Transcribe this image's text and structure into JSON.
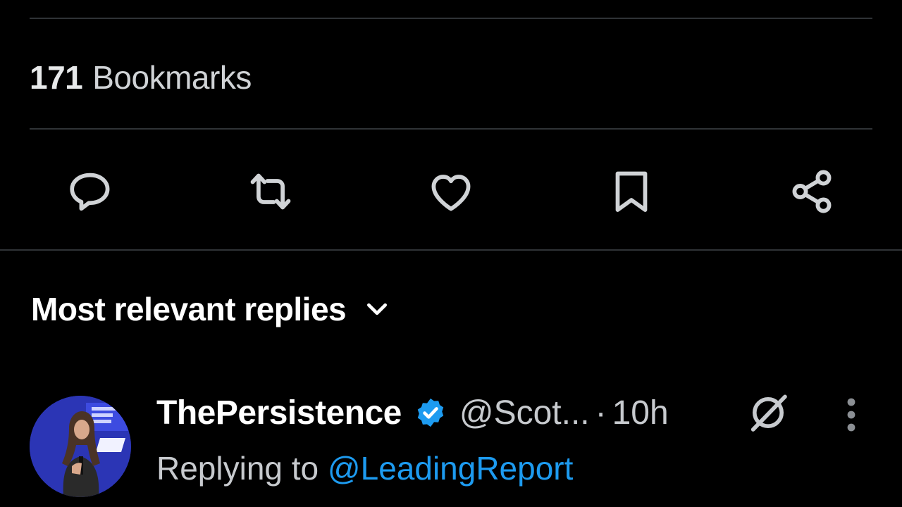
{
  "stats": {
    "bookmarks_count": "171",
    "bookmarks_label": "Bookmarks"
  },
  "actions": {
    "icons": [
      "reply-icon",
      "repost-icon",
      "like-icon",
      "bookmark-icon",
      "share-icon"
    ]
  },
  "replies": {
    "sort_label": "Most relevant replies"
  },
  "reply": {
    "display_name": "ThePersistence",
    "handle": "@Scot...",
    "separator": "·",
    "time": "10h",
    "replying_prefix": "Replying to",
    "replying_to": "@LeadingReport"
  },
  "colors": {
    "background": "#000000",
    "divider": "#2f3336",
    "text_primary": "#e7e9ea",
    "text_secondary": "#c7cace",
    "accent": "#1d9bf0"
  }
}
